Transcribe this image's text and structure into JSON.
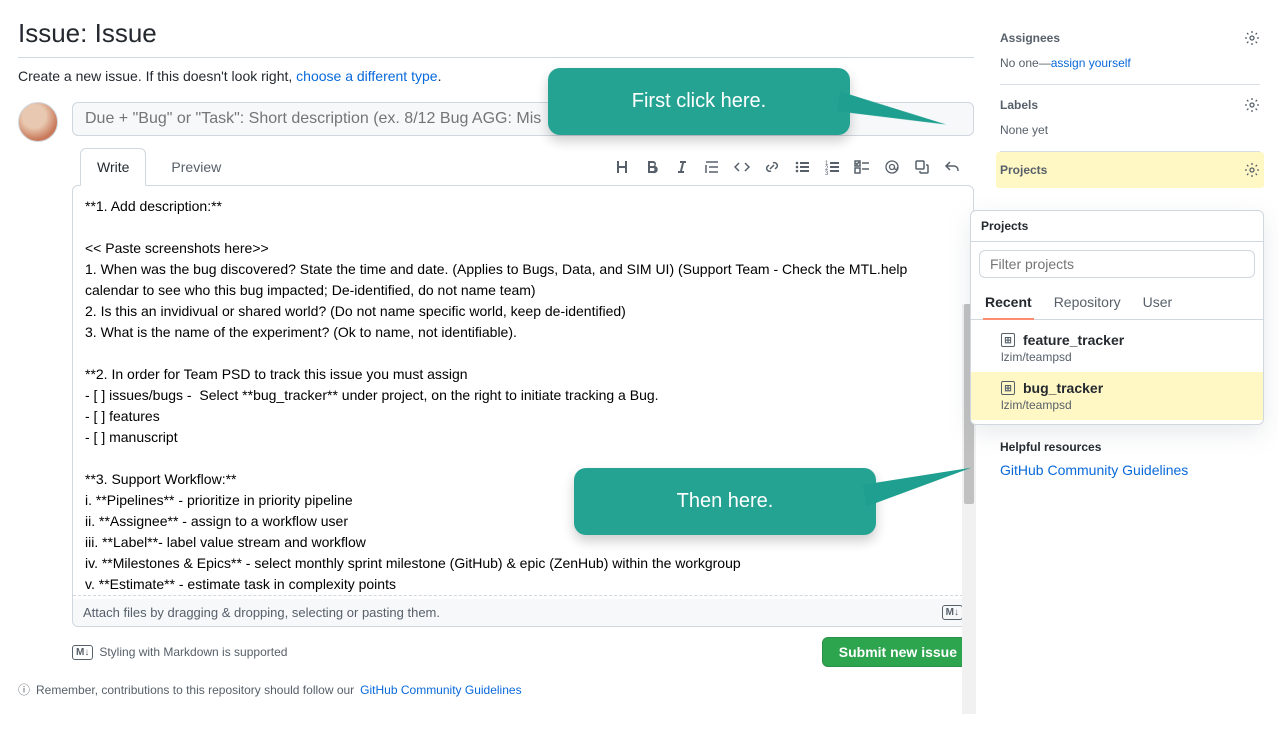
{
  "page": {
    "title": "Issue: Issue",
    "sub_prefix": "Create a new issue. If this doesn't look right, ",
    "sub_link": "choose a different type",
    "sub_suffix": "."
  },
  "composer": {
    "title_placeholder": "Due + \"Bug\" or \"Task\": Short description (ex. 8/12 Bug AGG: Mis",
    "tabs": {
      "write": "Write",
      "preview": "Preview"
    },
    "body": "**1. Add description:**\n\n<< Paste screenshots here>>\n1. When was the bug discovered? State the time and date. (Applies to Bugs, Data, and SIM UI) (Support Team - Check the MTL.help calendar to see who this bug impacted; De-identified, do not name team)\n2. Is this an invidivual or shared world? (Do not name specific world, keep de-identified)\n3. What is the name of the experiment? (Ok to name, not identifiable).\n\n**2. In order for Team PSD to track this issue you must assign\n- [ ] issues/bugs -  Select **bug_tracker** under project, on the right to initiate tracking a Bug.\n- [ ] features\n- [ ] manuscript\n\n**3. Support Workflow:**\ni. **Pipelines** - prioritize in priority pipeline\nii. **Assignee** - assign to a workflow user\niii. **Label**- label value stream and workflow\niv. **Milestones & Epics** - select monthly sprint milestone (GitHub) & epic (ZenHub) within the workgroup\nv. **Estimate** - estimate task in complexity points\nvi. **Epics** - assign to team-wide epic and TeamPSD master plan project",
    "attach_hint": "Attach files by dragging & dropping, selecting or pasting them.",
    "md_support": "Styling with Markdown is supported",
    "submit": "Submit new issue"
  },
  "footer": {
    "prefix": "Remember, contributions to this repository should follow our ",
    "link": "GitHub Community Guidelines"
  },
  "sidebar": {
    "assignees": {
      "title": "Assignees",
      "body_prefix": "No one—",
      "body_link": "assign yourself"
    },
    "labels": {
      "title": "Labels",
      "body": "None yet"
    },
    "projects": {
      "title": "Projects"
    }
  },
  "popover": {
    "title": "Projects",
    "filter_placeholder": "Filter projects",
    "tabs": {
      "recent": "Recent",
      "repository": "Repository",
      "user": "User"
    },
    "items": [
      {
        "name": "feature_tracker",
        "sub": "lzim/teampsd"
      },
      {
        "name": "bug_tracker",
        "sub": "lzim/teampsd"
      }
    ]
  },
  "helpful": {
    "title": "Helpful resources",
    "link": "GitHub Community Guidelines"
  },
  "callouts": {
    "c1": "First click here.",
    "c2": "Then here."
  },
  "icons": {
    "toolbar": [
      "heading",
      "bold",
      "italic",
      "quote",
      "code",
      "link",
      "ul",
      "ol",
      "tasklist",
      "mention",
      "reference",
      "reply"
    ]
  }
}
